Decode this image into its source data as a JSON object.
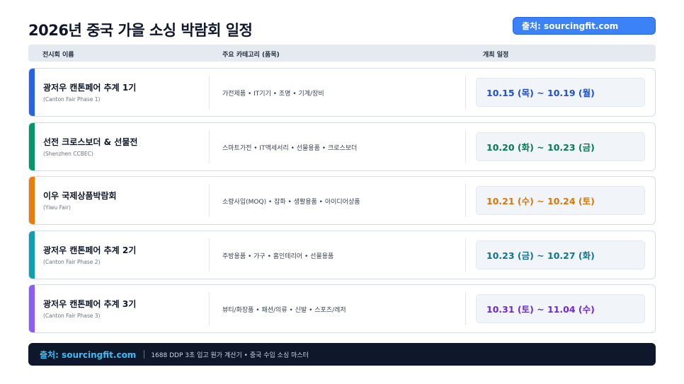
{
  "title": "2026년 중국 가을 소싱 박람회 일정",
  "source_badge": "출처: sourcingfit.com",
  "header": {
    "name": "전시회 이름",
    "category": "주요 카테고리 (품목)",
    "date": "개최 일정"
  },
  "rows": [
    {
      "name": "광저우 캔톤페어 추계 1기",
      "sub": "(Canton Fair Phase 1)",
      "category": "가전제품 • IT기기 • 조명 • 기계/장비",
      "date": "10.15 (목) ~ 10.19 (월)",
      "color": "#1d4ed8",
      "bar_color": "#2563eb"
    },
    {
      "name": "선전 크로스보더 & 선물전",
      "sub": "(Shenzhen CCBEC)",
      "category": "스마트가전 • IT액세서리 • 선물용품 • 크로스보더",
      "date": "10.20 (화) ~ 10.23 (금)",
      "color": "#047857",
      "bar_color": "#059669"
    },
    {
      "name": "이우 국제상품박람회",
      "sub": "(Yiwu Fair)",
      "category": "소량사입(MOQ) • 잡화 • 생활용품 • 아이디어상품",
      "date": "10.21 (수) ~ 10.24 (토)",
      "color": "#d97706",
      "bar_color": "#ea7c0c"
    },
    {
      "name": "광저우 캔톤페어 추계 2기",
      "sub": "(Canton Fair Phase 2)",
      "category": "주방용품 • 가구 • 홈인테리어 • 선물용품",
      "date": "10.23 (금) ~ 10.27 (화)",
      "color": "#0e7490",
      "bar_color": "#0e9fb3"
    },
    {
      "name": "광저우 캔톤페어 추계 3기",
      "sub": "(Canton Fair Phase 3)",
      "category": "뷰티/화장품 • 패션/의류 • 신발 • 스포츠/레저",
      "date": "10.31 (토) ~ 11.04 (수)",
      "color": "#6d28d9",
      "bar_color": "#8b5cf6"
    }
  ],
  "footer": {
    "source": "출처: sourcingfit.com",
    "text": "1688 DDP 3초 입고 원가 계산기 • 중국 수입 소싱 마스터"
  }
}
